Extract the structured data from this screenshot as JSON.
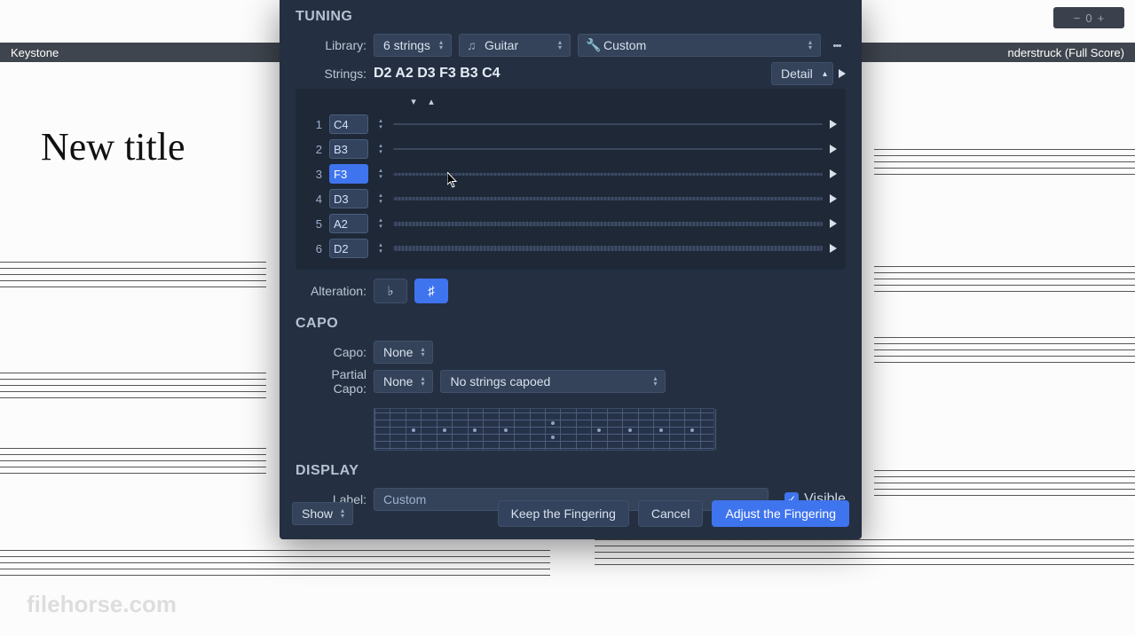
{
  "tabs": {
    "left": "Keystone",
    "right": "nderstruck (Full Score)"
  },
  "mini": {
    "value": "0"
  },
  "score": {
    "title": "New title"
  },
  "tuning": {
    "heading": "TUNING",
    "library_label": "Library:",
    "library_value": "6 strings",
    "instrument": "Guitar",
    "preset": "Custom",
    "strings_label": "Strings:",
    "strings_value": "D2 A2 D3 F3 B3 C4",
    "detail_label": "Detail",
    "strings": [
      {
        "n": "1",
        "note": "C4",
        "gauge": "thin"
      },
      {
        "n": "2",
        "note": "B3",
        "gauge": "thin"
      },
      {
        "n": "3",
        "note": "F3",
        "gauge": "med",
        "selected": true
      },
      {
        "n": "4",
        "note": "D3",
        "gauge": "med"
      },
      {
        "n": "5",
        "note": "A2",
        "gauge": "thick"
      },
      {
        "n": "6",
        "note": "D2",
        "gauge": "thick"
      }
    ],
    "alteration_label": "Alteration:",
    "flat": "♭",
    "sharp": "♯"
  },
  "capo": {
    "heading": "CAPO",
    "capo_label": "Capo:",
    "capo_value": "None",
    "partial_label": "Partial Capo:",
    "partial_value": "None",
    "partial_strings": "No strings capoed"
  },
  "display": {
    "heading": "DISPLAY",
    "label_label": "Label:",
    "label_value": "Custom",
    "visible_label": "Visible"
  },
  "footer": {
    "show": "Show",
    "keep": "Keep the Fingering",
    "cancel": "Cancel",
    "adjust": "Adjust the Fingering"
  },
  "watermark": "filehorse.com"
}
